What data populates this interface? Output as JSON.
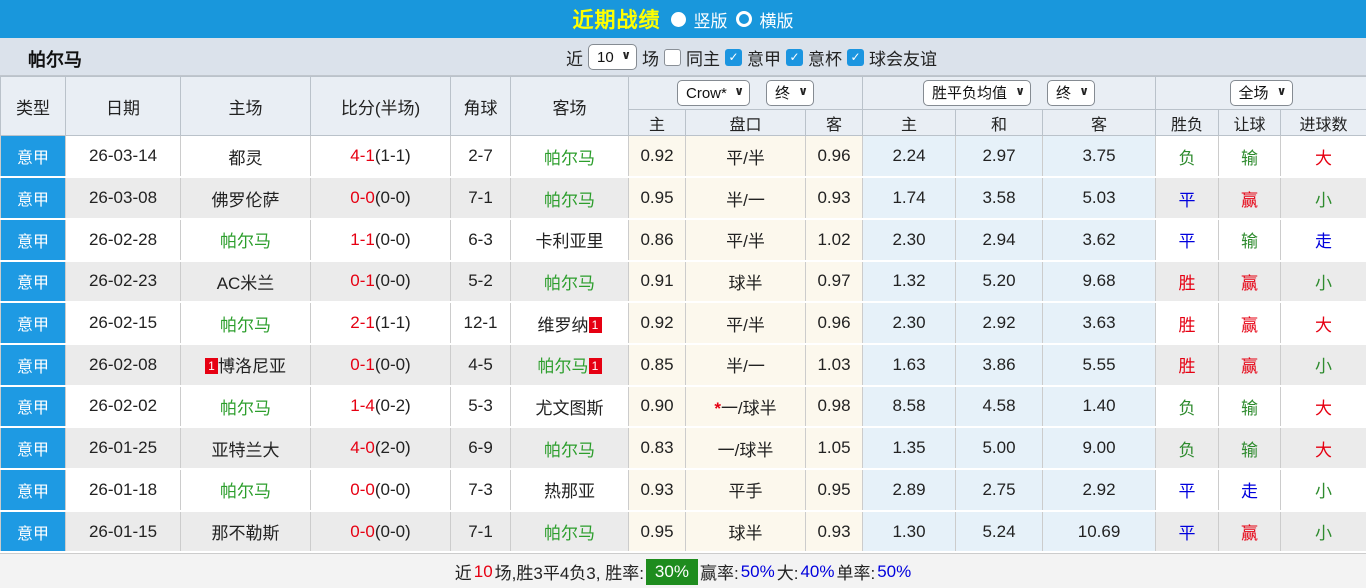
{
  "icons": {
    "chevron_down": "∨",
    "check": "✓",
    "asterisk": "*",
    "red_card": "red-card-count"
  },
  "colors": {
    "topbar_blue": "#1997dc",
    "title_yellow": "#ffff00",
    "league_blue": "#1e9ae3",
    "win_red": "#e60012",
    "draw_blue": "#0000dd",
    "lose_green": "#2e8b2e",
    "team_green": "#2c9e2c",
    "odds_cream_bg": "#fcf8ed",
    "avg_blue_bg": "#e6f1f9",
    "rate_green_bg": "#1e8c1e"
  },
  "topbar": {
    "title": "近期战绩",
    "radios": [
      {
        "label": "竖版",
        "selected": true
      },
      {
        "label": "横版",
        "selected": false
      }
    ]
  },
  "filterbar": {
    "team": "帕尔马",
    "near_label": "近",
    "near_value": "10",
    "field_label": "场",
    "checkboxes": [
      {
        "label": "同主",
        "checked": false
      },
      {
        "label": "意甲",
        "checked": true
      },
      {
        "label": "意杯",
        "checked": true
      },
      {
        "label": "球会友谊",
        "checked": true
      }
    ]
  },
  "header": {
    "col_type": "类型",
    "col_date": "日期",
    "col_home": "主场",
    "col_score": "比分(半场)",
    "col_corner": "角球",
    "col_away": "客场",
    "odds_company_select": "Crow*",
    "odds_state_select": "终",
    "odds_home": "主",
    "odds_handicap": "盘口",
    "odds_away": "客",
    "avg_select": "胜平负均值",
    "avg_state_select": "终",
    "avg_home": "主",
    "avg_draw": "和",
    "avg_away": "客",
    "scope_select": "全场",
    "col_result": "胜负",
    "col_handicap_result": "让球",
    "col_goals": "进球数"
  },
  "rows": [
    {
      "league": "意甲",
      "date": "26-03-14",
      "home": "都灵",
      "home_green": false,
      "score": "4-1",
      "half": "(1-1)",
      "corner": "2-7",
      "away": "帕尔马",
      "away_green": true,
      "o_home": "0.92",
      "handicap": "平/半",
      "handicap_star": false,
      "o_away": "0.96",
      "a_home": "2.24",
      "a_draw": "2.97",
      "a_away": "3.75",
      "res": "负",
      "res_c": "g",
      "let": "输",
      "let_c": "g",
      "goal": "大",
      "goal_c": "r"
    },
    {
      "league": "意甲",
      "date": "26-03-08",
      "home": "佛罗伦萨",
      "home_green": false,
      "score": "0-0",
      "half": "(0-0)",
      "corner": "7-1",
      "away": "帕尔马",
      "away_green": true,
      "o_home": "0.95",
      "handicap": "半/一",
      "handicap_star": false,
      "o_away": "0.93",
      "a_home": "1.74",
      "a_draw": "3.58",
      "a_away": "5.03",
      "res": "平",
      "res_c": "b",
      "let": "赢",
      "let_c": "r",
      "goal": "小",
      "goal_c": "g"
    },
    {
      "league": "意甲",
      "date": "26-02-28",
      "home": "帕尔马",
      "home_green": true,
      "score": "1-1",
      "half": "(0-0)",
      "corner": "6-3",
      "away": "卡利亚里",
      "away_green": false,
      "o_home": "0.86",
      "handicap": "平/半",
      "handicap_star": false,
      "o_away": "1.02",
      "a_home": "2.30",
      "a_draw": "2.94",
      "a_away": "3.62",
      "res": "平",
      "res_c": "b",
      "let": "输",
      "let_c": "g",
      "goal": "走",
      "goal_c": "b"
    },
    {
      "league": "意甲",
      "date": "26-02-23",
      "home": "AC米兰",
      "home_green": false,
      "score": "0-1",
      "half": "(0-0)",
      "corner": "5-2",
      "away": "帕尔马",
      "away_green": true,
      "o_home": "0.91",
      "handicap": "球半",
      "handicap_star": false,
      "o_away": "0.97",
      "a_home": "1.32",
      "a_draw": "5.20",
      "a_away": "9.68",
      "res": "胜",
      "res_c": "r",
      "let": "赢",
      "let_c": "r",
      "goal": "小",
      "goal_c": "g"
    },
    {
      "league": "意甲",
      "date": "26-02-15",
      "home": "帕尔马",
      "home_green": true,
      "score": "2-1",
      "half": "(1-1)",
      "corner": "12-1",
      "away": "维罗纳",
      "away_green": false,
      "away_badge": "1",
      "o_home": "0.92",
      "handicap": "平/半",
      "handicap_star": false,
      "o_away": "0.96",
      "a_home": "2.30",
      "a_draw": "2.92",
      "a_away": "3.63",
      "res": "胜",
      "res_c": "r",
      "let": "赢",
      "let_c": "r",
      "goal": "大",
      "goal_c": "r"
    },
    {
      "league": "意甲",
      "date": "26-02-08",
      "home": "博洛尼亚",
      "home_green": false,
      "home_badge": "1",
      "score": "0-1",
      "half": "(0-0)",
      "corner": "4-5",
      "away": "帕尔马",
      "away_green": true,
      "away_badge": "1",
      "o_home": "0.85",
      "handicap": "半/一",
      "handicap_star": false,
      "o_away": "1.03",
      "a_home": "1.63",
      "a_draw": "3.86",
      "a_away": "5.55",
      "res": "胜",
      "res_c": "r",
      "let": "赢",
      "let_c": "r",
      "goal": "小",
      "goal_c": "g"
    },
    {
      "league": "意甲",
      "date": "26-02-02",
      "home": "帕尔马",
      "home_green": true,
      "score": "1-4",
      "half": "(0-2)",
      "corner": "5-3",
      "away": "尤文图斯",
      "away_green": false,
      "o_home": "0.90",
      "handicap": "一/球半",
      "handicap_star": true,
      "o_away": "0.98",
      "a_home": "8.58",
      "a_draw": "4.58",
      "a_away": "1.40",
      "res": "负",
      "res_c": "g",
      "let": "输",
      "let_c": "g",
      "goal": "大",
      "goal_c": "r"
    },
    {
      "league": "意甲",
      "date": "26-01-25",
      "home": "亚特兰大",
      "home_green": false,
      "score": "4-0",
      "half": "(2-0)",
      "corner": "6-9",
      "away": "帕尔马",
      "away_green": true,
      "o_home": "0.83",
      "handicap": "一/球半",
      "handicap_star": false,
      "o_away": "1.05",
      "a_home": "1.35",
      "a_draw": "5.00",
      "a_away": "9.00",
      "res": "负",
      "res_c": "g",
      "let": "输",
      "let_c": "g",
      "goal": "大",
      "goal_c": "r"
    },
    {
      "league": "意甲",
      "date": "26-01-18",
      "home": "帕尔马",
      "home_green": true,
      "score": "0-0",
      "half": "(0-0)",
      "corner": "7-3",
      "away": "热那亚",
      "away_green": false,
      "o_home": "0.93",
      "handicap": "平手",
      "handicap_star": false,
      "o_away": "0.95",
      "a_home": "2.89",
      "a_draw": "2.75",
      "a_away": "2.92",
      "res": "平",
      "res_c": "b",
      "let": "走",
      "let_c": "b",
      "goal": "小",
      "goal_c": "g"
    },
    {
      "league": "意甲",
      "date": "26-01-15",
      "home": "那不勒斯",
      "home_green": false,
      "score": "0-0",
      "half": "(0-0)",
      "corner": "7-1",
      "away": "帕尔马",
      "away_green": true,
      "o_home": "0.95",
      "handicap": "球半",
      "handicap_star": false,
      "o_away": "0.93",
      "a_home": "1.30",
      "a_draw": "5.24",
      "a_away": "10.69",
      "res": "平",
      "res_c": "b",
      "let": "赢",
      "let_c": "r",
      "goal": "小",
      "goal_c": "g"
    }
  ],
  "footer": {
    "prefix": "近",
    "count": "10",
    "mid": "场,胜3平4负3, 胜率:",
    "win_rate": "30%",
    "lbl_win": "赢率:",
    "win_pct": "50%",
    "lbl_big": "大:",
    "big_pct": "40%",
    "lbl_single": "单率:",
    "single_pct": "50%"
  }
}
